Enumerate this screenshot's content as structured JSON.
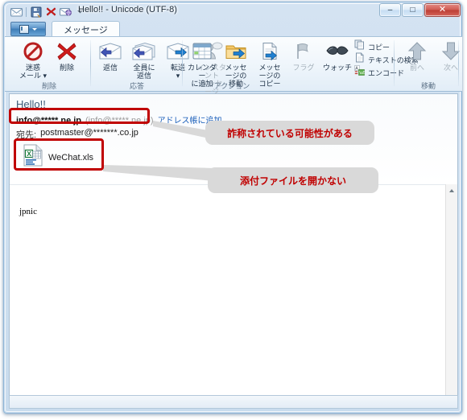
{
  "window": {
    "title": "Hello!! - Unicode (UTF-8)",
    "quick_access": [
      {
        "name": "envelope-icon",
        "label": ""
      },
      {
        "name": "save-icon",
        "label": ""
      },
      {
        "name": "delete-x-icon",
        "label": ""
      },
      {
        "name": "mail-globe-icon",
        "label": ""
      },
      {
        "name": "chevron-down-icon",
        "label": ""
      }
    ],
    "buttons": {
      "minimize": "–",
      "maximize": "□",
      "close": "✕"
    }
  },
  "tabs": {
    "app_button_label": "",
    "items": [
      {
        "label": "メッセージ",
        "active": true
      }
    ]
  },
  "ribbon": {
    "groups": [
      {
        "name": "delete",
        "label": "削除",
        "buttons": [
          {
            "icon": "junk-mail-icon",
            "label": "迷惑\nメール ▾",
            "disabled": false
          },
          {
            "icon": "delete-x-icon",
            "label": "削除",
            "disabled": false
          }
        ]
      },
      {
        "name": "respond",
        "label": "応答",
        "buttons": [
          {
            "icon": "reply-icon",
            "label": "返信",
            "disabled": false
          },
          {
            "icon": "reply-all-icon",
            "label": "全員に\n返信",
            "disabled": false
          },
          {
            "icon": "forward-icon",
            "label": "転送\n▾",
            "disabled": false
          },
          {
            "icon": "instant-message-icon",
            "label": "インスタント\nメッセージ",
            "disabled": true
          }
        ]
      },
      {
        "name": "actions",
        "label": "アクション",
        "buttons": [
          {
            "icon": "calendar-icon",
            "label": "カレンダー\nに追加",
            "disabled": false
          },
          {
            "icon": "move-message-icon",
            "label": "メッセージの\n移動",
            "disabled": false
          },
          {
            "icon": "copy-message-icon",
            "label": "メッセージの\nコピー",
            "disabled": false
          },
          {
            "icon": "flag-icon",
            "label": "フラグ",
            "disabled": true
          },
          {
            "icon": "watch-icon",
            "label": "ウォッチ",
            "disabled": false
          }
        ],
        "small_buttons": [
          {
            "icon": "copy-icon",
            "label": "コピー"
          },
          {
            "icon": "find-text-icon",
            "label": "テキストの検索"
          },
          {
            "icon": "encoding-icon",
            "label": "エンコード"
          }
        ]
      },
      {
        "name": "navigate",
        "label": "移動",
        "buttons": [
          {
            "icon": "arrow-up-icon",
            "label": "前へ",
            "disabled": true
          },
          {
            "icon": "arrow-down-icon",
            "label": "次へ",
            "disabled": true
          }
        ]
      }
    ]
  },
  "message": {
    "subject": "Hello!!",
    "sender": "info@*****.ne.jp",
    "sender_alt": "(info@*****.ne.jp)",
    "add_to_addressbook": "アドレス帳に追加",
    "to_label": "宛先:",
    "to_value": "postmaster@*******.co.jp",
    "attachment": {
      "name": "WeChat.xls",
      "icon": "excel-file-icon"
    },
    "body": "jpnic"
  },
  "annotations": {
    "colors": {
      "highlight": "#c00000",
      "callout_bg": "#d9d9d9",
      "callout_text": "#c00000"
    },
    "callouts": [
      {
        "name": "spoofing-warning",
        "text": "詐称されている可能性がある"
      },
      {
        "name": "attachment-warning",
        "text": "添付ファイルを開かない"
      }
    ]
  }
}
